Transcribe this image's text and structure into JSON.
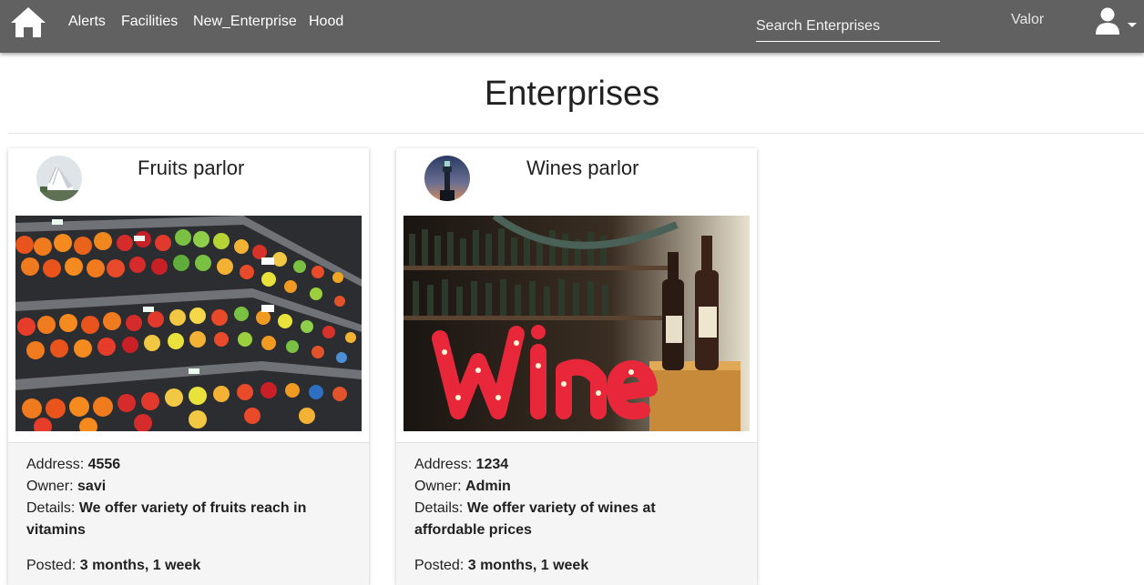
{
  "nav": {
    "links": [
      "Alerts",
      "Facilities",
      "New_Enterprise",
      "Hood"
    ],
    "search_placeholder": "Search Enterprises",
    "user_name": "Valor",
    "icons": {
      "home": "home-icon",
      "user": "user-icon",
      "dropdown": "caret-down-icon"
    }
  },
  "page": {
    "title": "Enterprises"
  },
  "labels": {
    "address": "Address:",
    "owner": "Owner:",
    "details": "Details:",
    "posted": "Posted:"
  },
  "cards": [
    {
      "title": "Fruits parlor",
      "address": "4556",
      "owner": "savi",
      "details": "We offer variety of fruits reach in vitamins",
      "posted": "3 months, 1 week"
    },
    {
      "title": "Wines parlor",
      "address": "1234",
      "owner": "Admin",
      "details": "We offer variety of wines at affordable prices",
      "posted": "3 months, 1 week"
    }
  ],
  "colors": {
    "navbar": "#616161",
    "card_body": "#f5f5f5",
    "wine_sign": "#e8283a"
  }
}
